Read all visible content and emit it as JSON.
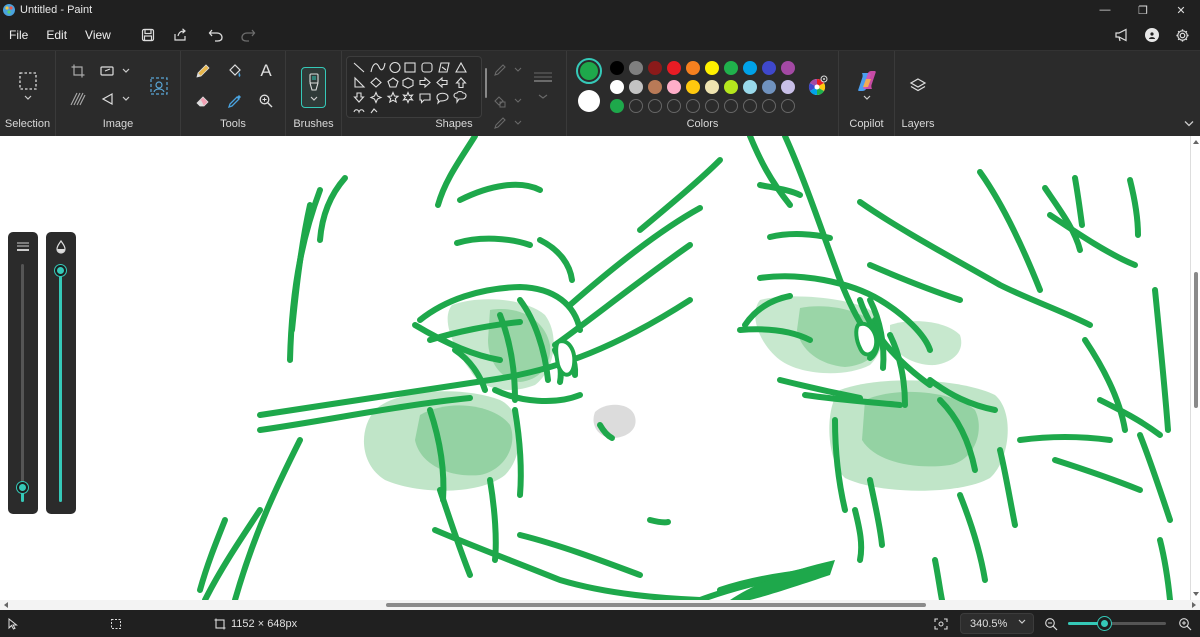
{
  "window": {
    "title": "Untitled - Paint",
    "minimize_glyph": "—",
    "maximize_glyph": "❐",
    "close_glyph": "✕"
  },
  "menu": {
    "items": [
      "File",
      "Edit",
      "View"
    ]
  },
  "ribbon": {
    "groups": {
      "selection": "Selection",
      "image": "Image",
      "tools": "Tools",
      "brushes": "Brushes",
      "shapes": "Shapes",
      "colors": "Colors",
      "copilot": "Copilot",
      "layers": "Layers"
    },
    "tools_text_glyph": "A",
    "colors": {
      "color1": "#1ea84b",
      "color2": "#ffffff",
      "palette_row1": [
        "#000000",
        "#7f7f7f",
        "#8b1a1a",
        "#e81c24",
        "#f6801f",
        "#fff100",
        "#20b14c",
        "#00a2e8",
        "#3f48cc",
        "#a349a4"
      ],
      "palette_row2": [
        "#ffffff",
        "#c3c3c3",
        "#b97a57",
        "#ffaec9",
        "#ffc90e",
        "#efe4b0",
        "#b5e61d",
        "#99d9ea",
        "#7092be",
        "#c8bfe7"
      ],
      "custom_row": [
        "#1ea84b"
      ]
    }
  },
  "canvas": {
    "stroke_color": "#1ea84b",
    "fill_color_light": "#b9e2c2",
    "fill_color_mid": "#8fcf9e"
  },
  "side_sliders": {
    "size_level": 0.06,
    "opacity_level": 0.97
  },
  "status": {
    "canvas_size": "1152 × 648px",
    "zoom": "340.5%",
    "zoom_level": 0.37,
    "zoom_out_glyph": "−",
    "zoom_in_glyph": "+"
  }
}
